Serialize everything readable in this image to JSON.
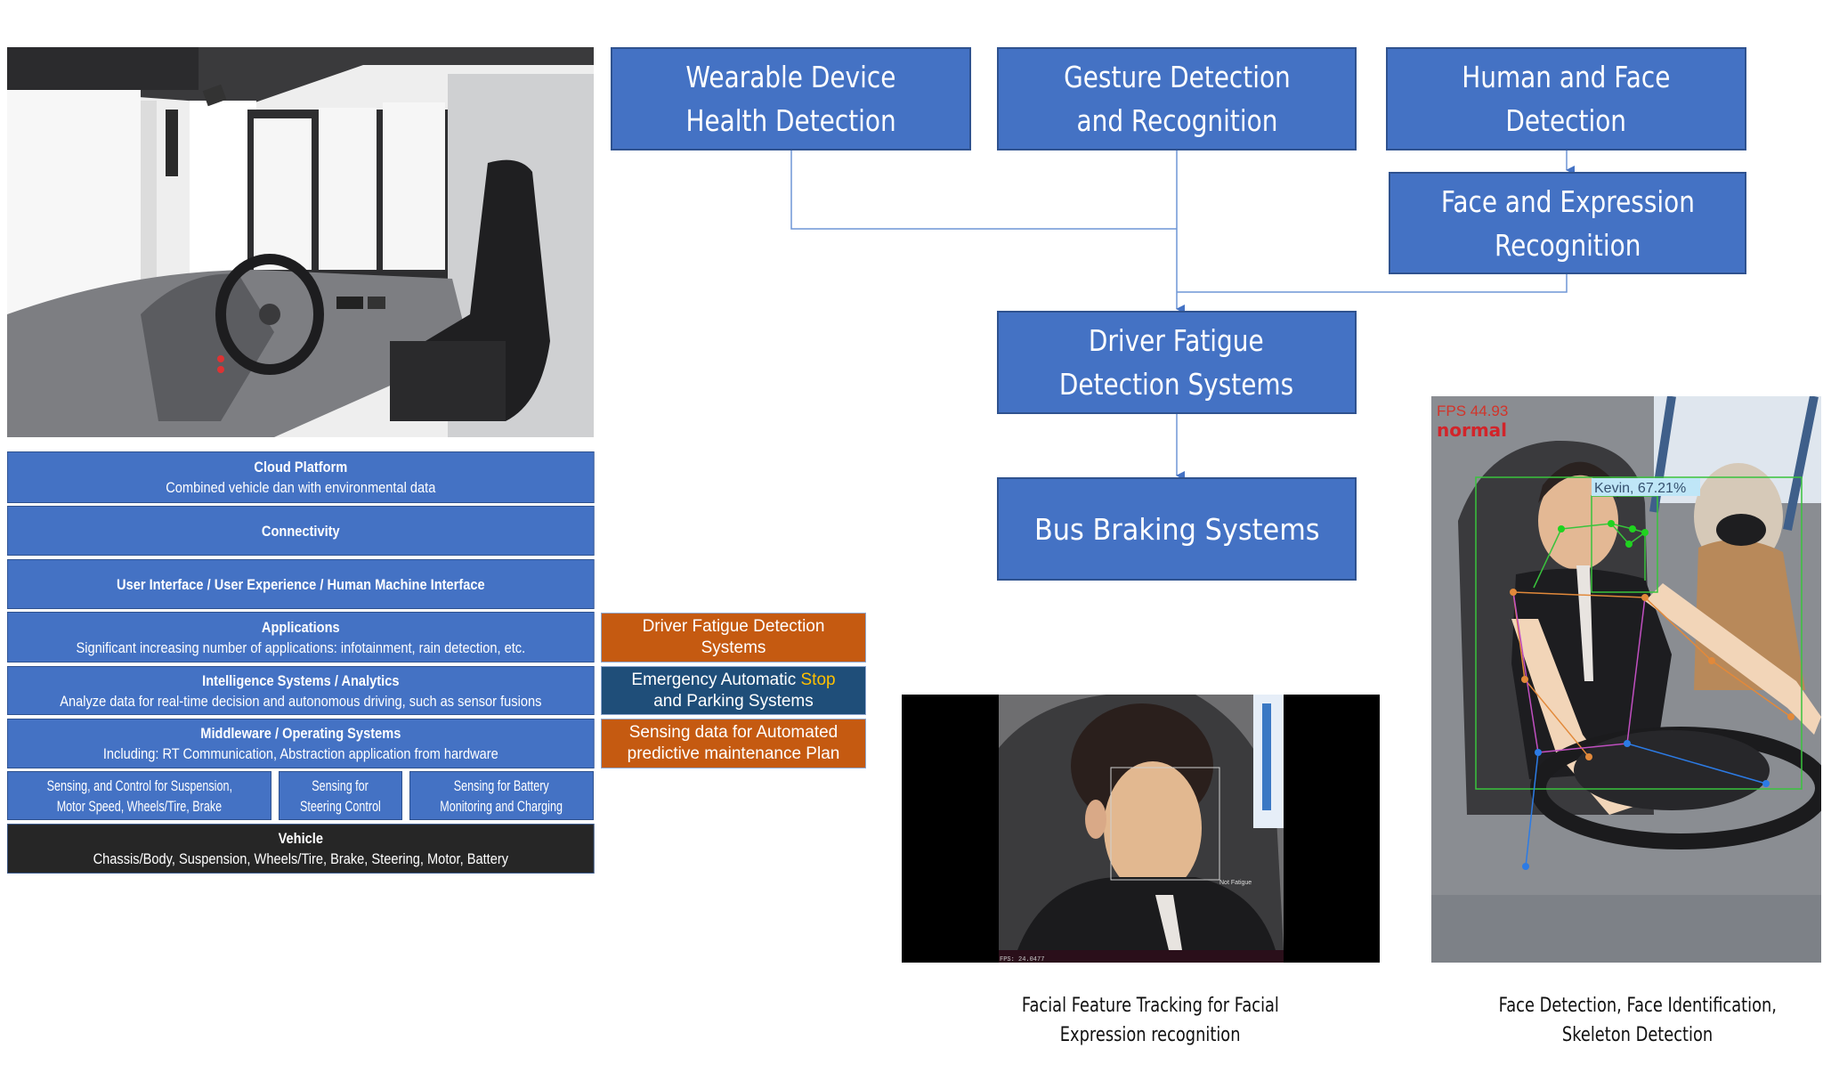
{
  "bus_photo": {
    "alt": "Bus driver cockpit interior with steering wheel, dashboard and driver seat"
  },
  "architecture_layers": [
    {
      "title": "Cloud Platform",
      "subtitle": "Combined vehicle dan with environmental data"
    },
    {
      "title": "Connectivity",
      "subtitle": ""
    },
    {
      "title": "User Interface / User Experience / Human Machine Interface",
      "subtitle": ""
    },
    {
      "title": "Applications",
      "subtitle": "Significant increasing number of applications: infotainment, rain detection, etc."
    },
    {
      "title": "Intelligence Systems / Analytics",
      "subtitle": "Analyze data for real-time decision and autonomous driving, such as sensor fusions"
    },
    {
      "title": "Middleware / Operating Systems",
      "subtitle": "Including: RT Communication, Abstraction application from hardware"
    }
  ],
  "sensing_row": [
    {
      "line1": "Sensing, and Control for Suspension,",
      "line2": "Motor Speed, Wheels/Tire, Brake"
    },
    {
      "line1": "Sensing for",
      "line2": "Steering Control"
    },
    {
      "line1": "Sensing for Battery",
      "line2": "Monitoring and Charging"
    }
  ],
  "vehicle_layer": {
    "title": "Vehicle",
    "subtitle": "Chassis/Body, Suspension, Wheels/Tire, Brake, Steering, Motor, Battery"
  },
  "side_boxes": [
    {
      "line1": "Driver Fatigue Detection",
      "line2": "Systems",
      "color": "#c55a11"
    },
    {
      "line1_pre": "Emergency Automatic ",
      "line1_highlight": "Stop",
      "line2": "and Parking Systems",
      "color": "#1f4e79",
      "highlight_color": "#ffc000"
    },
    {
      "line1": "Sensing data for Automated",
      "line2": "predictive maintenance Plan",
      "color": "#c55a11"
    }
  ],
  "flowchart": {
    "nodes": {
      "wearable": {
        "line1": "Wearable Device",
        "line2": "Health Detection"
      },
      "gesture": {
        "line1": "Gesture Detection",
        "line2": "and Recognition"
      },
      "human_face": {
        "line1": "Human and Face",
        "line2": "Detection"
      },
      "face_expression": {
        "line1": "Face and Expression",
        "line2": "Recognition"
      },
      "driver_fatigue": {
        "line1": "Driver Fatigue",
        "line2": "Detection Systems"
      },
      "bus_braking": {
        "line1": "Bus Braking Systems"
      }
    },
    "edges": [
      [
        "wearable",
        "driver_fatigue"
      ],
      [
        "gesture",
        "driver_fatigue"
      ],
      [
        "human_face",
        "face_expression"
      ],
      [
        "face_expression",
        "driver_fatigue"
      ],
      [
        "driver_fatigue",
        "bus_braking"
      ]
    ],
    "box_color": "#4472c4",
    "line_color": "#4472c4"
  },
  "facial_photo": {
    "status_label": "Not Fatigue",
    "fps_label": "FPS: 24.0477",
    "caption_line1": "Facial Feature Tracking for Facial",
    "caption_line2": "Expression recognition"
  },
  "skeleton_photo": {
    "fps_label": "FPS 44.93",
    "state_label": "normal",
    "identity_label": "Kevin, 67.21%",
    "caption_line1": "Face Detection, Face Identification,",
    "caption_line2": "Skeleton Detection"
  }
}
